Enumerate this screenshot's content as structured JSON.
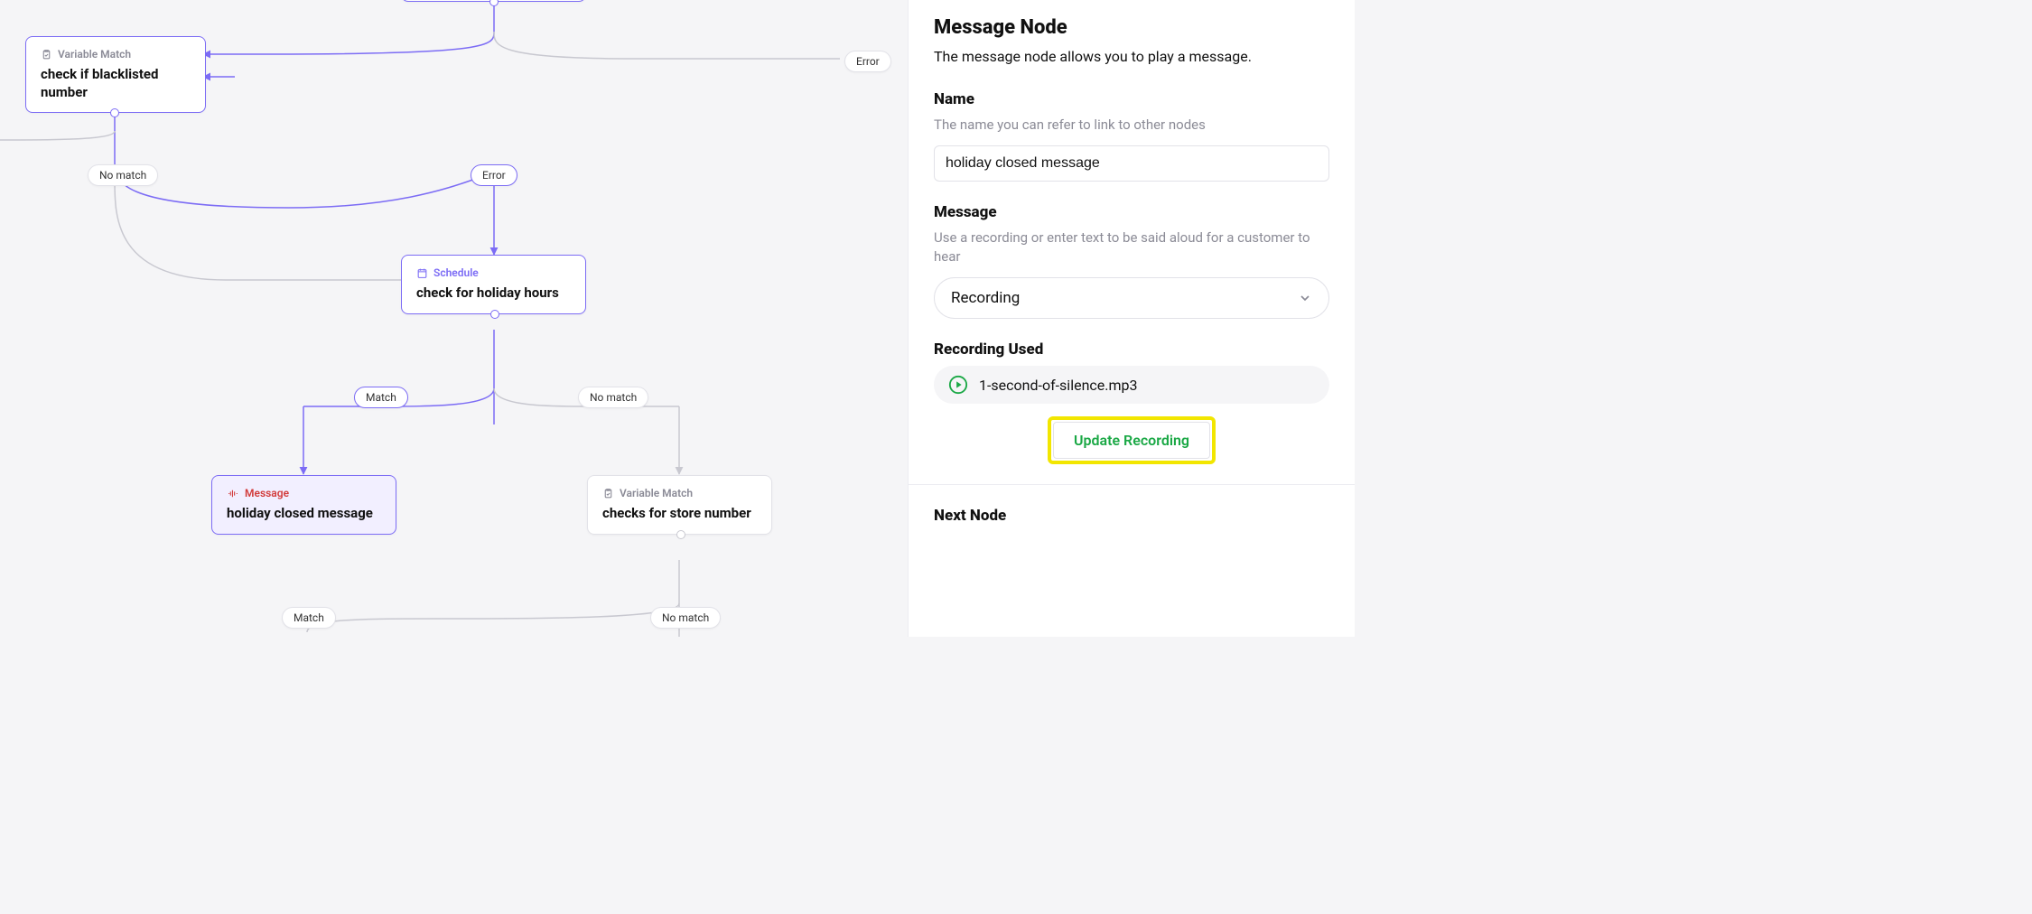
{
  "canvas": {
    "nodes": {
      "blacklist": {
        "type": "Variable Match",
        "title": "check if blacklisted number"
      },
      "holiday": {
        "type": "Schedule",
        "title": "check for holiday hours"
      },
      "msg": {
        "type": "Message",
        "title": "holiday closed message"
      },
      "store": {
        "type": "Variable Match",
        "title": "checks for store number"
      }
    },
    "pills": {
      "error_top": "Error",
      "no_match_left": "No match",
      "error_mid": "Error",
      "match_left": "Match",
      "no_match_right": "No match",
      "match_bottom": "Match",
      "no_match_bottom": "No match"
    }
  },
  "panel": {
    "title": "Message Node",
    "subtitle": "The message node allows you to play a message.",
    "name_label": "Name",
    "name_hint": "The name you can refer to link to other nodes",
    "name_value": "holiday closed message",
    "message_label": "Message",
    "message_hint": "Use a recording or enter text to be said aloud for a customer to hear",
    "message_select": "Recording",
    "recording_label": "Recording Used",
    "recording_file": "1-second-of-silence.mp3",
    "update_btn": "Update Recording",
    "next_label": "Next Node"
  }
}
